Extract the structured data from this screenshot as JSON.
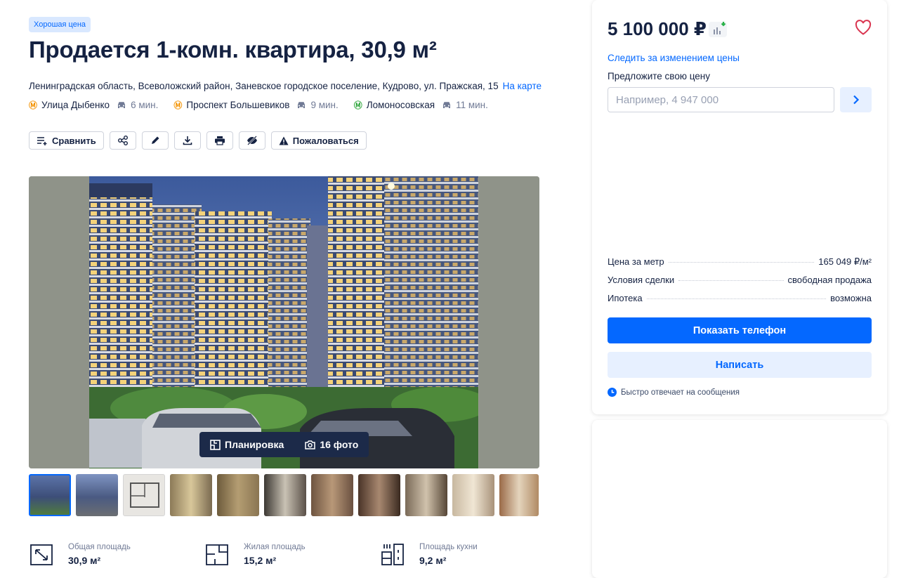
{
  "badge": "Хорошая цена",
  "title": "Продается 1-комн. квартира, 30,9 м²",
  "address": {
    "text": "Ленинградская область, Всеволожский район, Заневское городское поселение, Кудрово, ул. Пражская, 15",
    "map_link": "На карте"
  },
  "metro": [
    {
      "name": "Улица Дыбенко",
      "time": "6 мин.",
      "color": "#f39200"
    },
    {
      "name": "Проспект Большевиков",
      "time": "9 мин.",
      "color": "#f39200"
    },
    {
      "name": "Ломоносовская",
      "time": "11 мин.",
      "color": "#2da53a"
    }
  ],
  "toolbar": {
    "compare": "Сравнить",
    "complain": "Пожаловаться"
  },
  "gallery": {
    "layout_label": "Планировка",
    "photos_label": "16 фото"
  },
  "features": [
    {
      "label": "Общая площадь",
      "value": "30,9 м²",
      "icon": "total-area-icon"
    },
    {
      "label": "Жилая площадь",
      "value": "15,2 м²",
      "icon": "living-area-icon"
    },
    {
      "label": "Площадь кухни",
      "value": "9,2 м²",
      "icon": "kitchen-area-icon"
    }
  ],
  "sidebar": {
    "price": "5 100 000 ₽",
    "follow_price": "Следить за изменением цены",
    "offer_label": "Предложите свою цену",
    "offer_placeholder": "Например, 4 947 000",
    "params": [
      {
        "label": "Цена за метр",
        "value": "165 049 ₽/м²"
      },
      {
        "label": "Условия сделки",
        "value": "свободная продажа"
      },
      {
        "label": "Ипотека",
        "value": "возможна"
      }
    ],
    "show_phone": "Показать телефон",
    "write": "Написать",
    "fast_reply": "Быстро отвечает на сообщения"
  },
  "colors": {
    "accent": "#0468ff",
    "text": "#152242",
    "muted": "#707a95",
    "heart": "#d9344f",
    "price_down": "#2bb34a"
  }
}
